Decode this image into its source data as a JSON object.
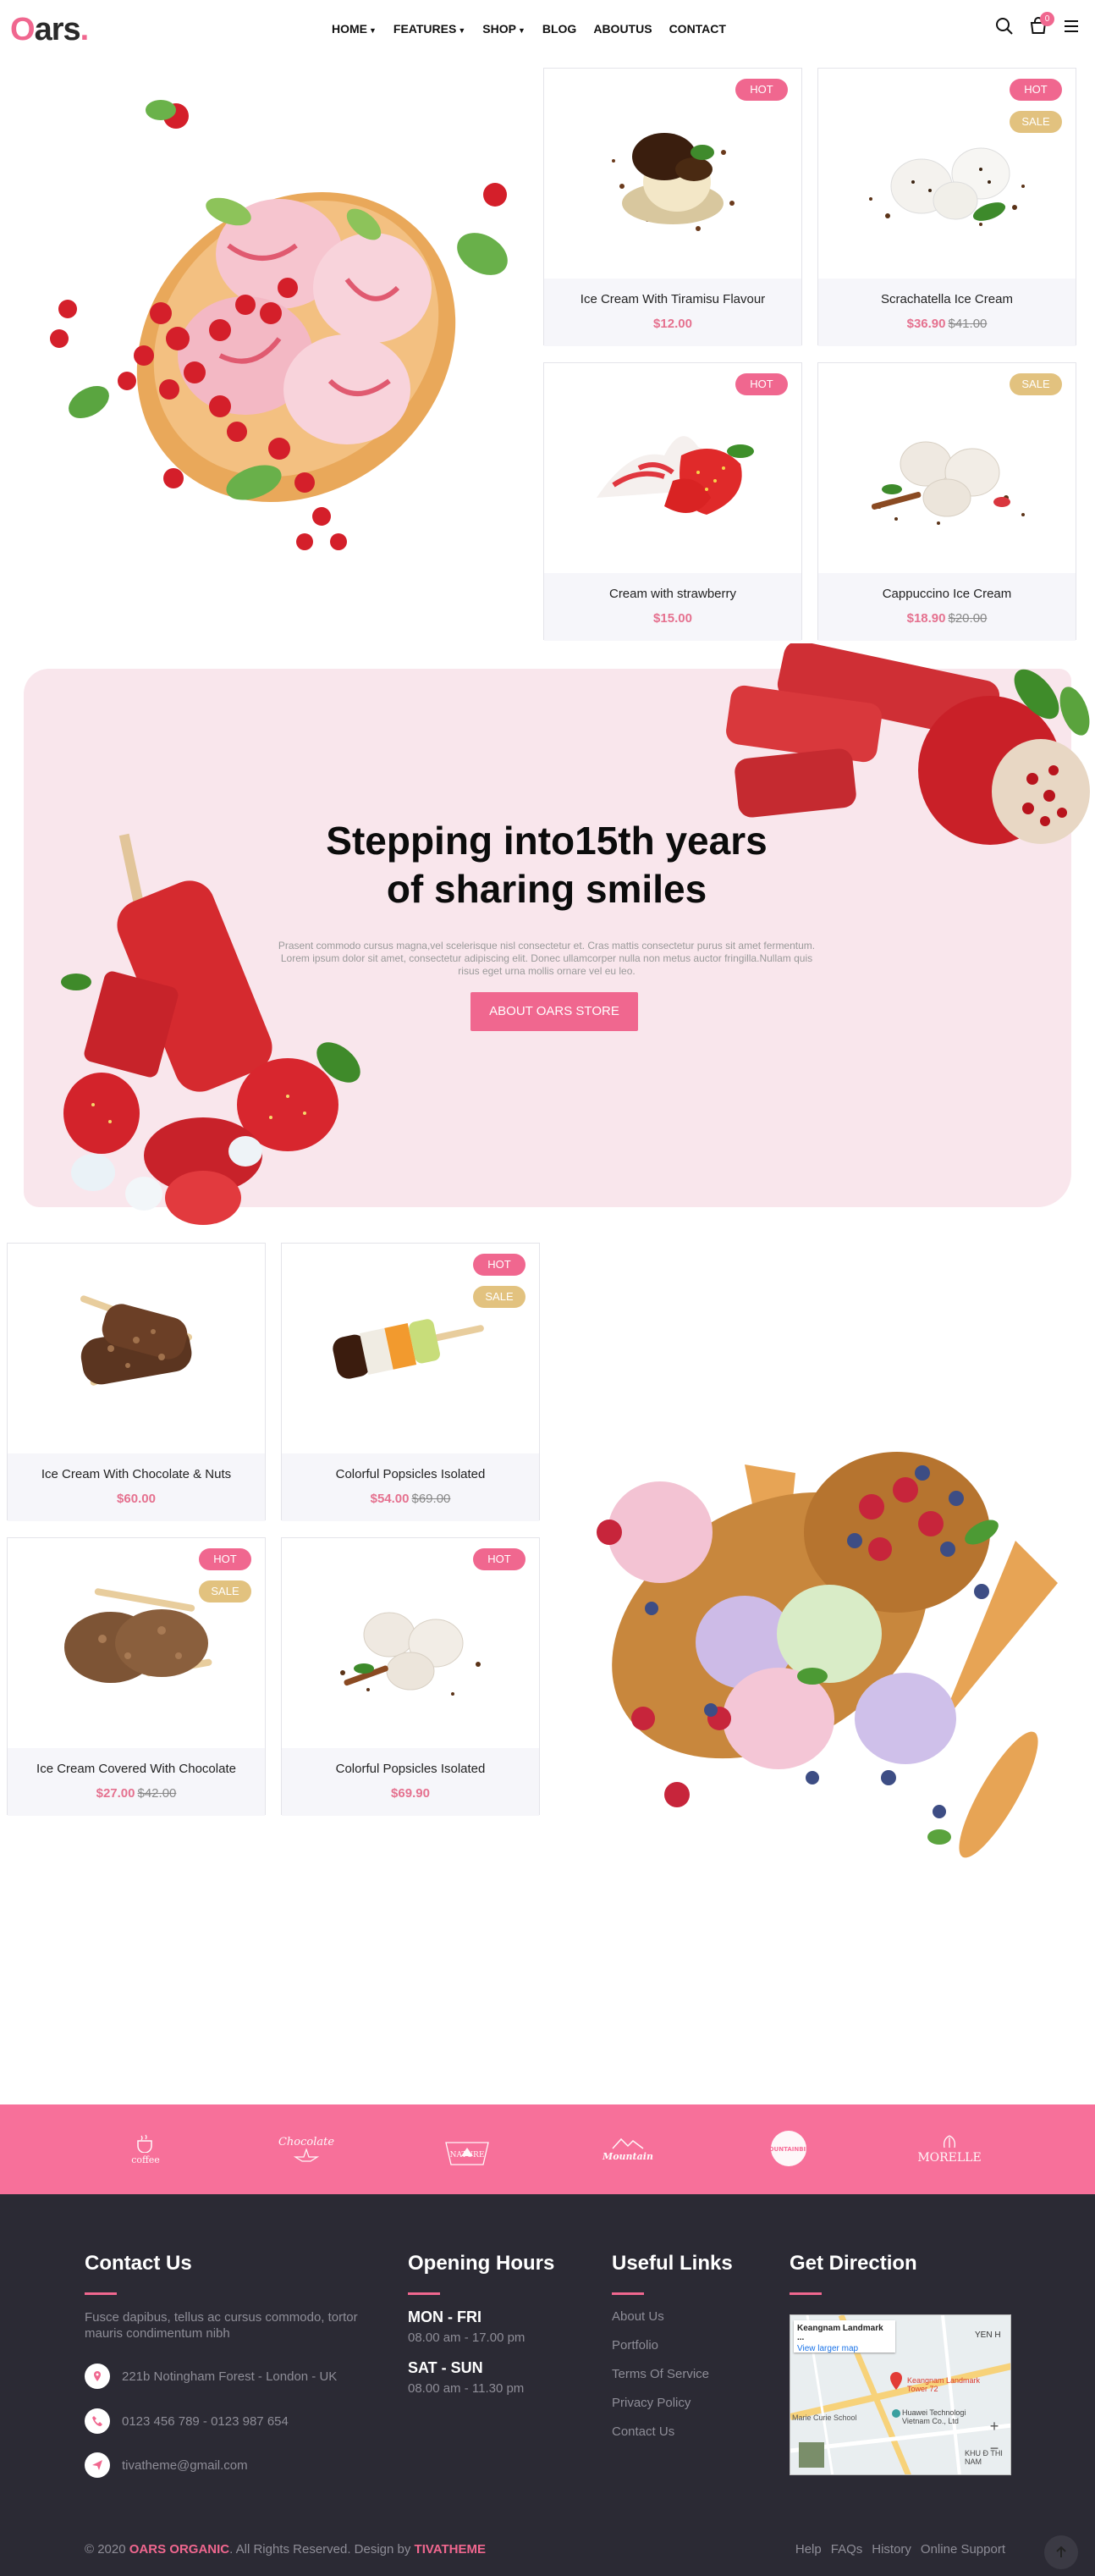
{
  "header": {
    "logo": "Oars.",
    "nav": [
      {
        "label": "HOME",
        "dropdown": true
      },
      {
        "label": "FEATURES",
        "dropdown": true
      },
      {
        "label": "SHOP",
        "dropdown": true
      },
      {
        "label": "BLOG",
        "dropdown": false
      },
      {
        "label": "ABOUTUS",
        "dropdown": false
      },
      {
        "label": "CONTACT",
        "dropdown": false
      }
    ],
    "cart_count": "0",
    "icons": [
      "search-icon",
      "cart-icon",
      "menu-icon"
    ]
  },
  "products_top": [
    {
      "name": "Ice Cream With Tiramisu Flavour",
      "price": "$12.00",
      "old_price": "",
      "badges": [
        "HOT"
      ]
    },
    {
      "name": "Scrachatella Ice Cream",
      "price": "$36.90",
      "old_price": "$41.00",
      "badges": [
        "HOT",
        "SALE"
      ]
    },
    {
      "name": "Cream with strawberry",
      "price": "$15.00",
      "old_price": "",
      "badges": [
        "HOT"
      ]
    },
    {
      "name": "Cappuccino Ice Cream",
      "price": "$18.90",
      "old_price": "$20.00",
      "badges": [
        "SALE"
      ]
    }
  ],
  "banner": {
    "title_line1": "Stepping into15th years",
    "title_line2": "of sharing smiles",
    "text": "Prasent commodo cursus magna,vel scelerisque nisl consectetur et. Cras mattis consectetur purus sit amet fermentum. Lorem ipsum dolor sit amet, consectetur adipiscing elit. Donec ullamcorper nulla non metus auctor fringilla.Nullam quis risus eget urna mollis ornare vel eu leo.",
    "button": "ABOUT OARS STORE"
  },
  "products_bottom": [
    {
      "name": "Ice Cream With Chocolate & Nuts",
      "price": "$60.00",
      "old_price": "",
      "badges": []
    },
    {
      "name": "Colorful Popsicles Isolated",
      "price": "$54.00",
      "old_price": "$69.00",
      "badges": [
        "HOT",
        "SALE"
      ]
    },
    {
      "name": "Ice Cream Covered With Chocolate",
      "price": "$27.00",
      "old_price": "$42.00",
      "badges": [
        "HOT",
        "SALE"
      ]
    },
    {
      "name": "Colorful Popsicles Isolated",
      "price": "$69.90",
      "old_price": "",
      "badges": [
        "HOT"
      ]
    }
  ],
  "brands": [
    "coffee",
    "Chocolate",
    "NATURE",
    "Mountain",
    "MOUNTAINBIKE",
    "MORELLE"
  ],
  "footer": {
    "contact": {
      "title": "Contact Us",
      "text": "Fusce dapibus, tellus ac cursus commodo, tortor mauris condimentum nibh",
      "address": "221b Notingham Forest - London - UK",
      "phone": "0123 456 789 - 0123 987 654",
      "email": "tivatheme@gmail.com"
    },
    "hours": {
      "title": "Opening Hours",
      "day1": "MON - FRI",
      "time1": "08.00 am - 17.00 pm",
      "day2": "SAT - SUN",
      "time2": "08.00 am - 11.30 pm"
    },
    "links": {
      "title": "Useful Links",
      "items": [
        "About Us",
        "Portfolio",
        "Terms Of Service",
        "Privacy Policy",
        "Contact Us"
      ]
    },
    "direction": {
      "title": "Get Direction",
      "map_place": "Keangnam Landmark ...",
      "map_link": "View larger map",
      "map_pin": "Keangnam Landmark Tower 72",
      "map_labels": [
        "YEN H",
        "Huawei Technologi Vietnam Co., Ltd",
        "Marie Curie School",
        "KHU Đ THI NAM"
      ]
    },
    "copyright_pre": "© 2020 ",
    "copyright_brand": "OARS ORGANIC",
    "copyright_mid": ". All Rights Reserved. Design by ",
    "copyright_designer": "TIVATHEME",
    "bottom_links": [
      "Help",
      "FAQs",
      "History",
      "Online Support"
    ]
  }
}
